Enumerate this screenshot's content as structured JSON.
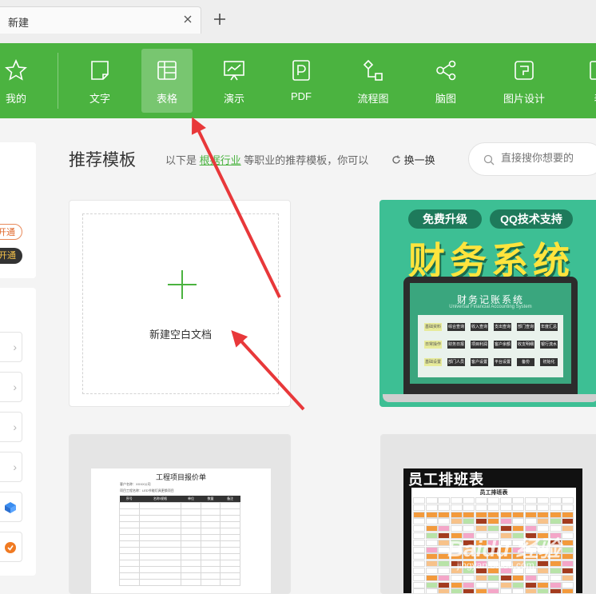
{
  "tab": {
    "label": "新建"
  },
  "toolbar": {
    "items": [
      {
        "label": "我的",
        "icon": "star-icon"
      },
      {
        "label": "文字",
        "icon": "document-icon"
      },
      {
        "label": "表格",
        "icon": "table-icon"
      },
      {
        "label": "演示",
        "icon": "presentation-icon"
      },
      {
        "label": "PDF",
        "icon": "pdf-icon"
      },
      {
        "label": "流程图",
        "icon": "flowchart-icon"
      },
      {
        "label": "脑图",
        "icon": "mindmap-icon"
      },
      {
        "label": "图片设计",
        "icon": "image-design-icon"
      },
      {
        "label": "表",
        "icon": "more-icon"
      }
    ],
    "active_label": "表格",
    "colors": {
      "bar": "#4bb340",
      "accent": "#4bb340"
    }
  },
  "sidebar": {
    "pill_1": "开通",
    "pill_2": "开通"
  },
  "section": {
    "title": "推荐模板",
    "desc_prefix": "以下是",
    "desc_link": "根据行业",
    "desc_suffix": "等职业的推荐模板，你可以",
    "swap_label": "换一换"
  },
  "search": {
    "placeholder": "直接搜你想要的"
  },
  "cards": {
    "blank": {
      "label": "新建空白文档"
    },
    "finance": {
      "pill_left": "免费升级",
      "pill_right": "QQ技术支持",
      "headline": "财务系统",
      "screen_title": "财务记账系统",
      "screen_subtitle": "Universal Financial Accounting System",
      "modules": [
        {
          "label": "基础资料",
          "tag": true
        },
        {
          "label": "综合查询"
        },
        {
          "label": "收入查询"
        },
        {
          "label": "支出查询"
        },
        {
          "label": "部门查询"
        },
        {
          "label": "年度汇总"
        },
        {
          "label": "日常操作",
          "tag": true
        },
        {
          "label": "财务日报"
        },
        {
          "label": "项目利润"
        },
        {
          "label": "客户余额"
        },
        {
          "label": "收支明细"
        },
        {
          "label": "银行流水"
        },
        {
          "label": "基础设置",
          "tag": true
        },
        {
          "label": "部门人员"
        },
        {
          "label": "客户设置"
        },
        {
          "label": "平台设置"
        },
        {
          "label": "备份"
        },
        {
          "label": "初始化"
        }
      ]
    },
    "quote": {
      "title": "工程项目报价单",
      "meta_1": "客户名称：XXXX公司",
      "meta_2": "项目工程名称：LED节能灯具更换项目",
      "columns": [
        "序号",
        "名称/规格",
        "单位",
        "数量",
        "备注"
      ]
    },
    "roster": {
      "headline": "员工排班表",
      "sheet_title": "员工排班表"
    }
  },
  "watermark": {
    "main": "Baidu 经验",
    "sub": "jingyan.baidu.com"
  }
}
